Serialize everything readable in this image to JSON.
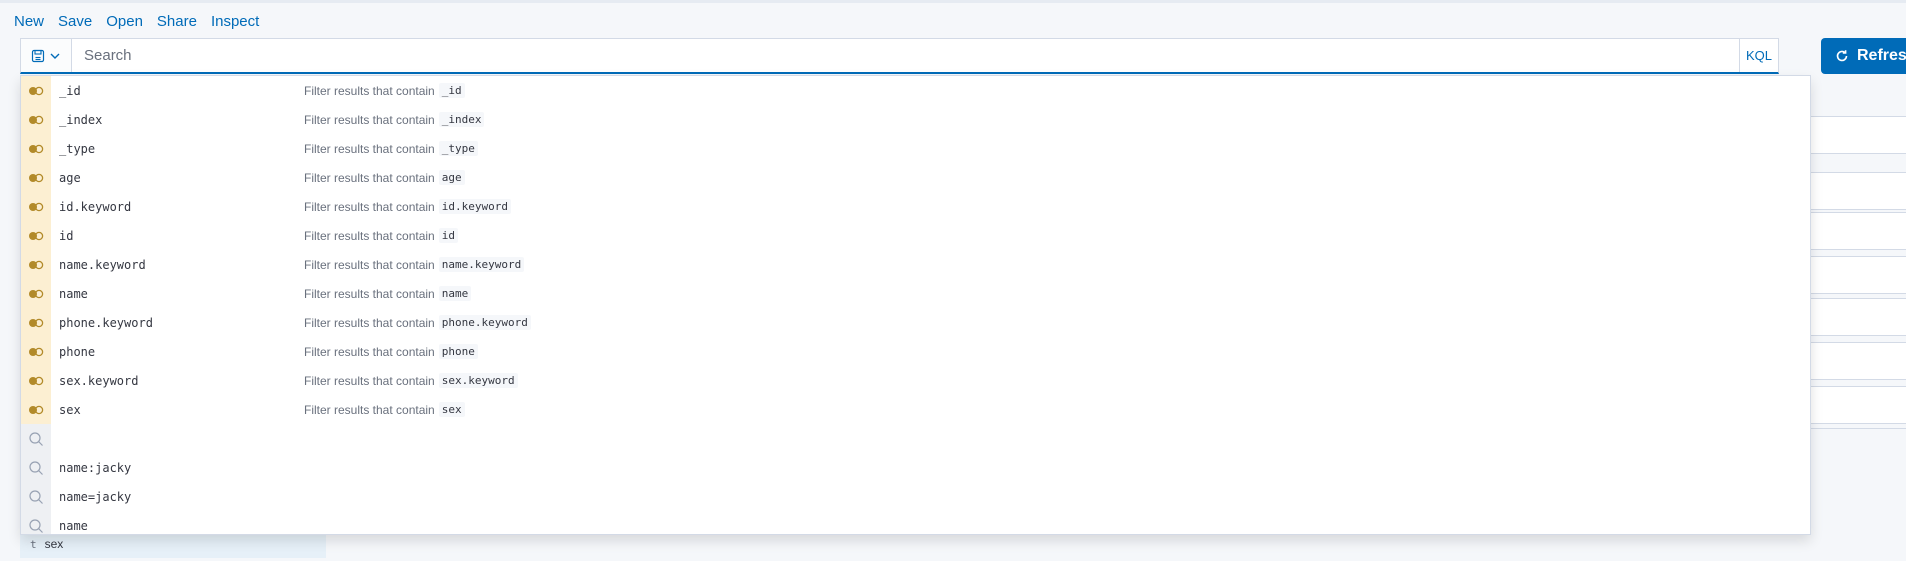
{
  "menu": {
    "items": [
      {
        "id": "new",
        "label": "New"
      },
      {
        "id": "save",
        "label": "Save"
      },
      {
        "id": "open",
        "label": "Open"
      },
      {
        "id": "share",
        "label": "Share"
      },
      {
        "id": "inspect",
        "label": "Inspect"
      }
    ]
  },
  "search": {
    "placeholder": "Search",
    "value": "",
    "language_label": "KQL"
  },
  "refresh": {
    "label": "Refresh"
  },
  "sidebar": {
    "field_type": "t",
    "field_name": "sex"
  },
  "suggestions": {
    "field_description_prefix": "Filter results that contain",
    "fields": [
      "_id",
      "_index",
      "_type",
      "age",
      "id.keyword",
      "id",
      "name.keyword",
      "name",
      "phone.keyword",
      "phone",
      "sex.keyword",
      "sex"
    ],
    "recent": [
      "",
      "name:jacky",
      "name=jacky",
      "name"
    ]
  },
  "colors": {
    "accent": "#006bb8",
    "field_icon_bg": "#fcefd2",
    "field_icon": "#b28a29",
    "recent_icon_bg": "#eef0f3"
  }
}
